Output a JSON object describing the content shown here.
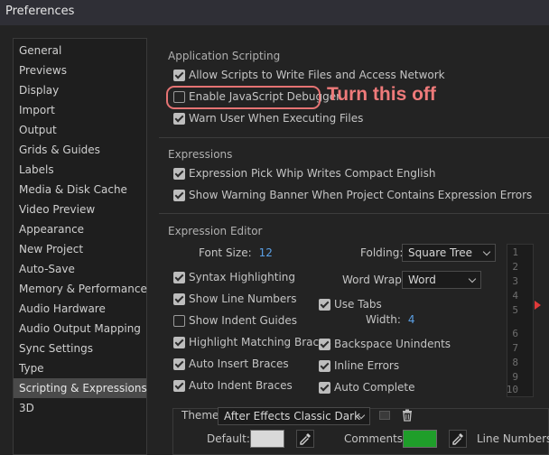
{
  "window": {
    "title": "Preferences"
  },
  "sidebar": {
    "items": [
      {
        "label": "General"
      },
      {
        "label": "Previews"
      },
      {
        "label": "Display"
      },
      {
        "label": "Import"
      },
      {
        "label": "Output"
      },
      {
        "label": "Grids & Guides"
      },
      {
        "label": "Labels"
      },
      {
        "label": "Media & Disk Cache"
      },
      {
        "label": "Video Preview"
      },
      {
        "label": "Appearance"
      },
      {
        "label": "New Project"
      },
      {
        "label": "Auto-Save"
      },
      {
        "label": "Memory & Performance"
      },
      {
        "label": "Audio Hardware"
      },
      {
        "label": "Audio Output Mapping"
      },
      {
        "label": "Sync Settings"
      },
      {
        "label": "Type"
      },
      {
        "label": "Scripting & Expressions"
      },
      {
        "label": "3D"
      }
    ],
    "selected": "Scripting & Expressions"
  },
  "app_scripting": {
    "title": "Application Scripting",
    "allow_scripts": {
      "label": "Allow Scripts to Write Files and Access Network",
      "checked": true
    },
    "enable_debugger": {
      "label": "Enable JavaScript Debugger",
      "checked": false
    },
    "warn_user": {
      "label": "Warn User When Executing Files",
      "checked": true
    },
    "annotation": "Turn this off"
  },
  "expressions": {
    "title": "Expressions",
    "pick_whip": {
      "label": "Expression Pick Whip Writes Compact English",
      "checked": true
    },
    "warning_banner": {
      "label": "Show Warning Banner When Project Contains Expression Errors",
      "checked": true
    }
  },
  "editor": {
    "title": "Expression Editor",
    "font_size_label": "Font Size:",
    "font_size_value": "12",
    "folding_label": "Folding:",
    "folding_value": "Square Tree",
    "word_wrap_label": "Word Wrap:",
    "word_wrap_value": "Word",
    "use_tabs": {
      "label": "Use Tabs",
      "checked": true
    },
    "width_label": "Width:",
    "width_value": "4",
    "syntax_highlighting": {
      "label": "Syntax Highlighting",
      "checked": true
    },
    "show_line_numbers": {
      "label": "Show Line Numbers",
      "checked": true
    },
    "show_indent_guides": {
      "label": "Show Indent Guides",
      "checked": false
    },
    "highlight_braces": {
      "label": "Highlight Matching Braces",
      "checked": true
    },
    "auto_insert_braces": {
      "label": "Auto Insert Braces",
      "checked": true
    },
    "auto_indent_braces": {
      "label": "Auto Indent Braces",
      "checked": true
    },
    "backspace_unindents": {
      "label": "Backspace Unindents",
      "checked": true
    },
    "inline_errors": {
      "label": "Inline Errors",
      "checked": true
    },
    "auto_complete": {
      "label": "Auto Complete",
      "checked": true
    },
    "line_numbers": [
      "1",
      "2",
      "3",
      "4",
      "5",
      "6",
      "7",
      "8",
      "9",
      "10"
    ],
    "theme_label": "Theme:",
    "theme_value": "After Effects Classic Dark",
    "default_label": "Default:",
    "comments_label": "Comments:",
    "line_numbers_label": "Line Numbers:",
    "default_color": "#d9d9d9",
    "comments_color": "#1f9e2a"
  }
}
